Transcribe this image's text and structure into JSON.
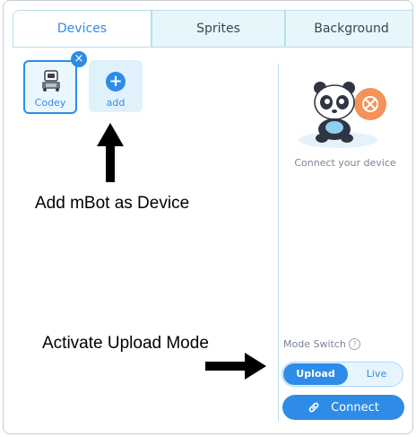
{
  "tabs": [
    {
      "label": "Devices",
      "active": true
    },
    {
      "label": "Sprites",
      "active": false
    },
    {
      "label": "Background",
      "active": false
    }
  ],
  "devices": {
    "selected_label": "Codey",
    "add_label": "add"
  },
  "annotations": {
    "add_device": "Add mBot as Device",
    "upload_mode": "Activate Upload Mode"
  },
  "connect_panel": {
    "hint": "Connect your device",
    "mode_switch_label": "Mode Switch",
    "mode_options": [
      "Upload",
      "Live"
    ],
    "selected_mode": "Upload",
    "connect_label": "Connect"
  },
  "colors": {
    "accent": "#2e8ce8",
    "tab_inactive_bg": "#e6f6fb",
    "border": "#b9ddea"
  },
  "icons": [
    "close-icon",
    "codey-robot-icon",
    "plus-icon",
    "panda-mascot-icon",
    "help-icon",
    "link-icon",
    "arrow-up-icon",
    "arrow-right-icon"
  ]
}
